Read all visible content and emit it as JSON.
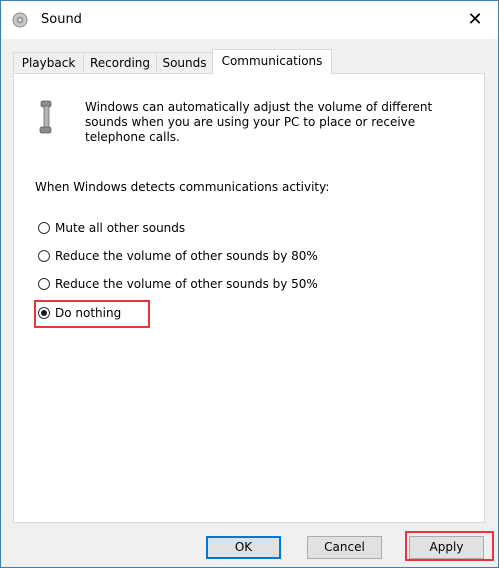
{
  "window": {
    "title": "Sound",
    "close_glyph": "✕",
    "app_icon": "speaker-icon"
  },
  "tabs": [
    {
      "label": "Playback",
      "active": false
    },
    {
      "label": "Recording",
      "active": false
    },
    {
      "label": "Sounds",
      "active": false
    },
    {
      "label": "Communications",
      "active": true
    }
  ],
  "communications": {
    "icon": "telephone-handset-icon",
    "description": "Windows can automatically adjust the volume of different sounds when you are using your PC to place or receive telephone calls.",
    "prompt": "When Windows detects communications activity:",
    "options": [
      {
        "label": "Mute all other sounds",
        "checked": false
      },
      {
        "label": "Reduce the volume of other sounds by 80%",
        "checked": false
      },
      {
        "label": "Reduce the volume of other sounds by 50%",
        "checked": false
      },
      {
        "label": "Do nothing",
        "checked": true
      }
    ]
  },
  "buttons": {
    "ok": "OK",
    "cancel": "Cancel",
    "apply": "Apply"
  },
  "colors": {
    "highlight": "#e8353e",
    "default_button_border": "#0078d7",
    "window_border": "#3c7fb1"
  }
}
